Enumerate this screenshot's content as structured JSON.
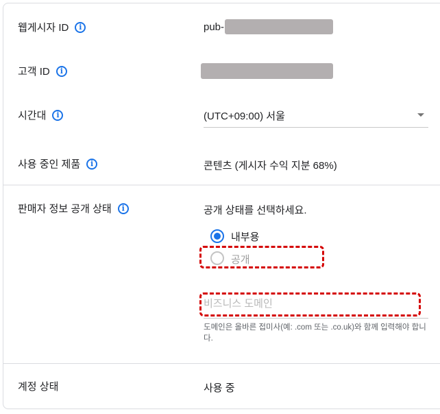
{
  "rows": {
    "publisher_id": {
      "label": "웹게시자 ID",
      "value_prefix": "pub-"
    },
    "customer_id": {
      "label": "고객 ID"
    },
    "timezone": {
      "label": "시간대",
      "value": "(UTC+09:00) 서울"
    },
    "products": {
      "label": "사용 중인 제품",
      "value": "콘텐츠 (게시자 수익 지분 68%)"
    },
    "seller_info": {
      "label": "판매자 정보 공개 상태",
      "prompt": "공개 상태를 선택하세요.",
      "options": [
        {
          "label": "내부용",
          "selected": true
        },
        {
          "label": "공개",
          "selected": false
        }
      ],
      "domain_placeholder": "비즈니스 도메인",
      "domain_value": "",
      "helper": "도메인은 올바른 접미사(예: .com 또는 .co.uk)와 함께 입력해야 합니다."
    },
    "account_status": {
      "label": "계정 상태",
      "value": "사용 중"
    }
  },
  "colors": {
    "accent": "#1a73e8",
    "highlight": "#d40000",
    "redaction": "#b3afb0"
  },
  "icons": {
    "info": "info-circle-icon",
    "dropdown": "caret-down-icon"
  }
}
